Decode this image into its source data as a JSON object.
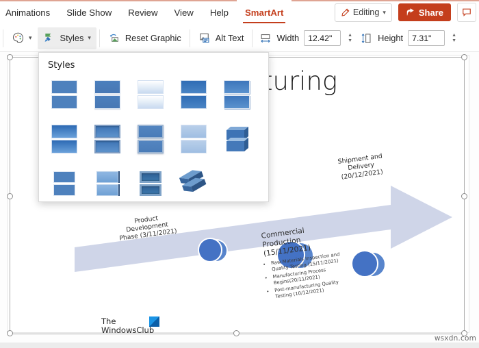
{
  "app": {
    "name": "PowerPoint Online - SmartArt editing"
  },
  "menubar": {
    "items": [
      {
        "label": "Animations",
        "active": false
      },
      {
        "label": "Slide Show",
        "active": false
      },
      {
        "label": "Review",
        "active": false
      },
      {
        "label": "View",
        "active": false
      },
      {
        "label": "Help",
        "active": false
      },
      {
        "label": "SmartArt",
        "active": true
      }
    ],
    "editing_label": "Editing",
    "share_label": "Share",
    "comment_icon": "comment-icon",
    "pencil_icon": "pencil-icon",
    "share_icon": "share-arrow-icon"
  },
  "ribbon": {
    "color_icon": "color-palette-icon",
    "styles_icon": "styles-brush-icon",
    "styles_label": "Styles",
    "reset_icon": "reset-graphic-icon",
    "reset_label": "Reset Graphic",
    "alt_text_icon": "alt-text-icon",
    "alt_text_label": "Alt Text",
    "width_icon": "width-arrows-icon",
    "width_label": "Width",
    "width_value": "12.42\"",
    "height_icon": "height-arrows-icon",
    "height_label": "Height",
    "height_value": "7.31\""
  },
  "styles_popup": {
    "title": "Styles",
    "thumbnails": [
      {
        "name": "simple-fill",
        "variant": "v-flat"
      },
      {
        "name": "subtle-effect",
        "variant": "v-sub"
      },
      {
        "name": "white-outline",
        "variant": "v-light"
      },
      {
        "name": "intense-effect",
        "variant": "v-int"
      },
      {
        "name": "moderate-effect",
        "variant": "v-mod"
      },
      {
        "name": "polished",
        "variant": "v-grad"
      },
      {
        "name": "inset",
        "variant": "v-inset"
      },
      {
        "name": "cartoon",
        "variant": "v-card"
      },
      {
        "name": "powder",
        "variant": "v-pale"
      },
      {
        "name": "brick-scene",
        "variant": "v-brick"
      },
      {
        "name": "flat-scene",
        "variant": "v-small"
      },
      {
        "name": "metallic-scene",
        "variant": "v-bevel"
      },
      {
        "name": "sunset-scene",
        "variant": "v-deep"
      },
      {
        "name": "birds-eye-scene",
        "variant": "v-cube"
      }
    ]
  },
  "slide": {
    "title": "acturing",
    "smartart": {
      "nodes": [
        {
          "name": "product-development",
          "label": "Product\nDevelopment\nPhase (3/11/2021)"
        },
        {
          "name": "commercial-production",
          "heading": "Commercial\nProduction\n(15/11/2021)",
          "bullets": [
            "Raw Materials Inspection and Quality Testing (15/11/2021)",
            "Manufacturing Process Begins(20/11/2021)",
            "Post-manufacturing Quality Testing (10/12/2021)"
          ]
        },
        {
          "name": "shipment-delivery",
          "label": "Shipment and\nDelivery\n(20/12/2021)"
        }
      ],
      "accent_color": "#4472c4",
      "band_color": "#c7cee4"
    },
    "watermark": {
      "line1": "The",
      "line2": "WindowsClub",
      "logo": "windowsclub-logo"
    }
  },
  "footer": {
    "source_watermark": "wsxdn.com"
  }
}
